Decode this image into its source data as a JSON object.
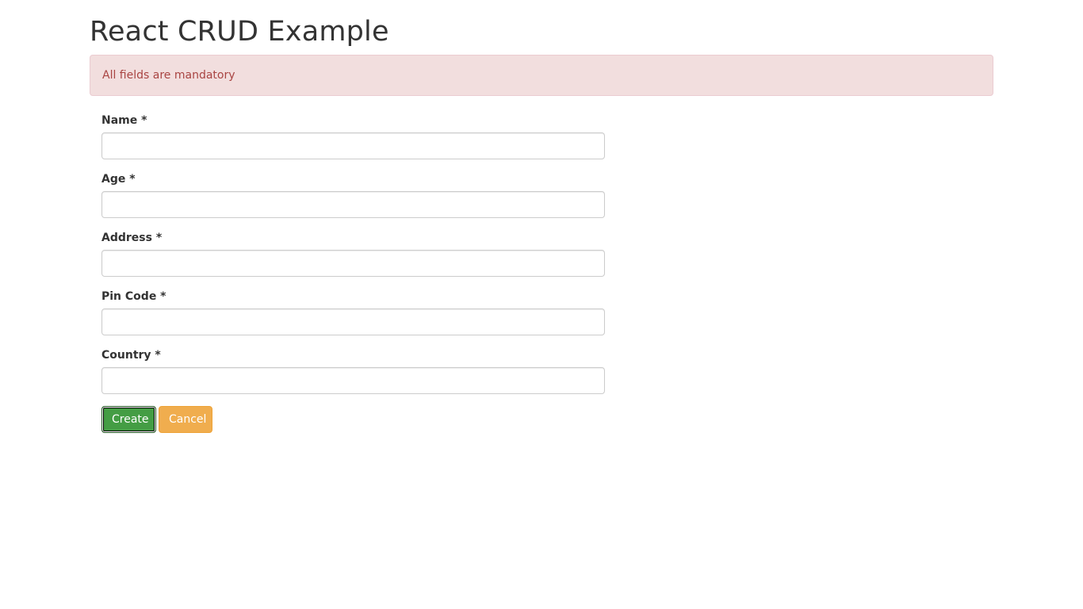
{
  "page": {
    "title": "React CRUD Example"
  },
  "alert": {
    "message": "All fields are mandatory"
  },
  "form": {
    "fields": [
      {
        "label": "Name *",
        "value": "",
        "placeholder": ""
      },
      {
        "label": "Age *",
        "value": "",
        "placeholder": ""
      },
      {
        "label": "Address *",
        "value": "",
        "placeholder": ""
      },
      {
        "label": "Pin Code *",
        "value": "",
        "placeholder": ""
      },
      {
        "label": "Country *",
        "value": "",
        "placeholder": ""
      }
    ],
    "create_label": "Create",
    "cancel_label": "Cancel"
  },
  "colors": {
    "alert_bg": "#f2dede",
    "alert_text": "#a94442",
    "create_button": "#449d44",
    "cancel_button": "#f0ad4e"
  }
}
